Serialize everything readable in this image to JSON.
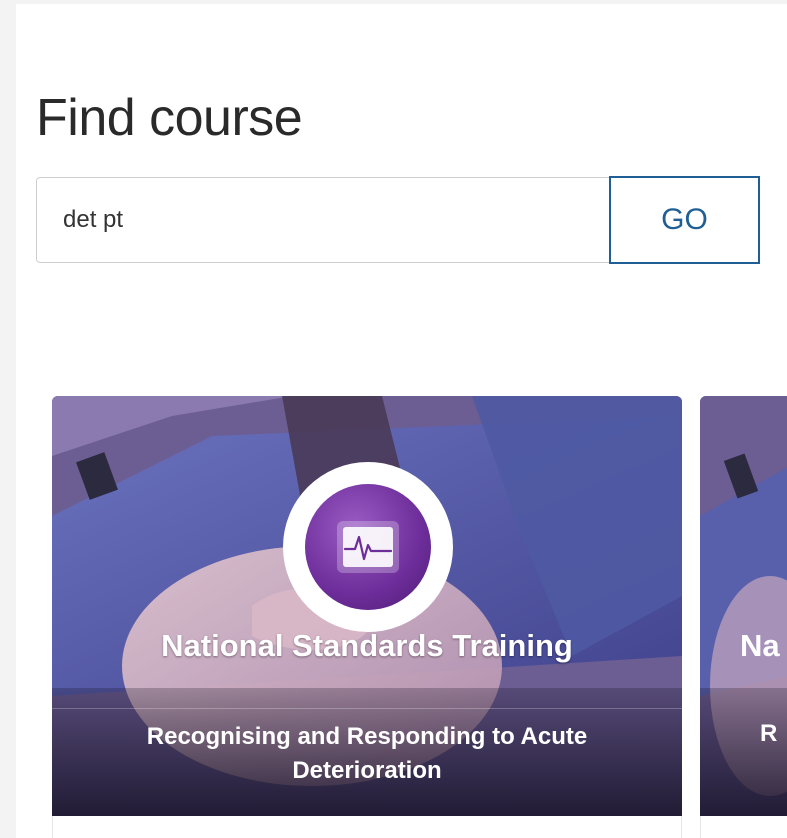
{
  "page": {
    "title": "Find course"
  },
  "search": {
    "value": "det pt",
    "button_label": "GO"
  },
  "cards": [
    {
      "title": "National Standards Training",
      "subtitle": "Recognising and Responding to Acute Deterioration",
      "icon": "heart-monitor-icon"
    },
    {
      "title": "Na",
      "subtitle": "R",
      "icon": "heart-monitor-icon"
    }
  ],
  "colors": {
    "accent": "#1f5f96",
    "card_overlay": "#2b2450",
    "badge_purple": "#6d2d9a"
  }
}
